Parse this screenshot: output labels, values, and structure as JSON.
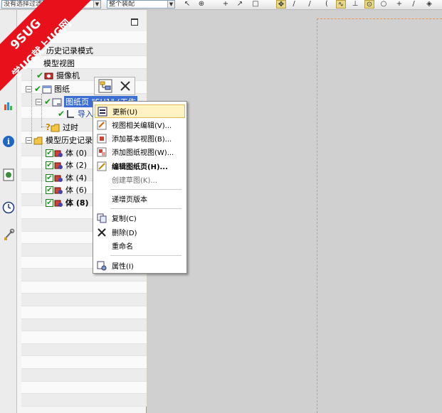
{
  "toolbar": {
    "combo_left": "没有选择过滤器",
    "combo_right": "整个装配"
  },
  "watermark": {
    "line1": "9SUG",
    "line2": "学UG就上UG网"
  },
  "tree": {
    "items": [
      {
        "label": "历史记录模式"
      },
      {
        "label": "模型视图"
      },
      {
        "label": "摄像机"
      },
      {
        "label": "图纸"
      },
      {
        "label": "图纸页 \"SH1\" (工作"
      },
      {
        "label": "导入的"
      },
      {
        "label": "过时"
      },
      {
        "label": "模型历史记录"
      },
      {
        "label": "体 (0)"
      },
      {
        "label": "体 (2)"
      },
      {
        "label": "体 (4)"
      },
      {
        "label": "体 (6)"
      },
      {
        "label": "体 (8)"
      }
    ]
  },
  "context_menu": {
    "items": [
      {
        "label": "更新(U)"
      },
      {
        "label": "视图相关编辑(V)..."
      },
      {
        "label": "添加基本视图(B)..."
      },
      {
        "label": "添加图纸视图(W)..."
      },
      {
        "label": "编辑图纸页(H)..."
      },
      {
        "label": "创建草图(K)..."
      },
      {
        "label": "递增页版本"
      },
      {
        "label": "复制(C)"
      },
      {
        "label": "删除(D)"
      },
      {
        "label": "重命名"
      },
      {
        "label": "属性(I)"
      }
    ]
  },
  "colors": {
    "watermark_red": "#e8101b",
    "selection_blue": "#3a6ed5",
    "check_green": "#1d9a1d",
    "graphics_bg": "#d0d0d0",
    "sheet_border": "#e89a55"
  }
}
